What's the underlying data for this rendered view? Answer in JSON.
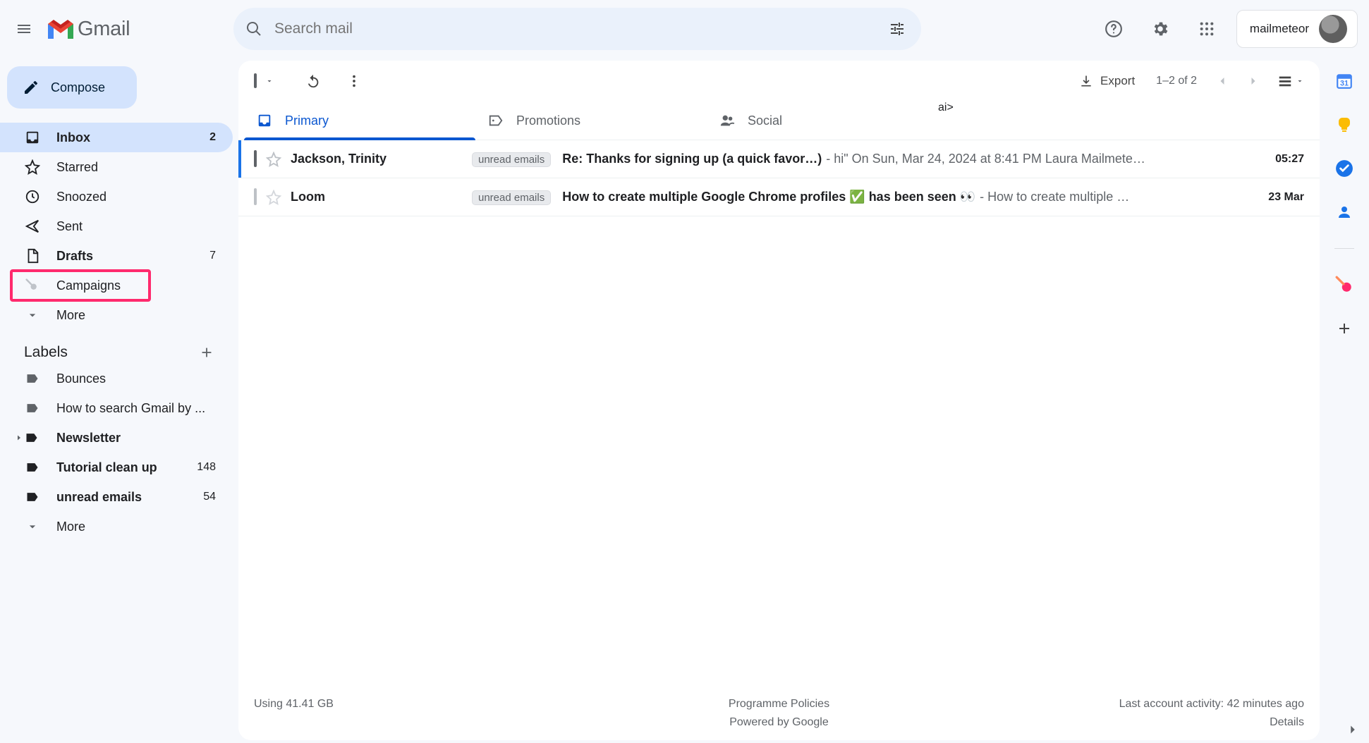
{
  "app": {
    "name": "Gmail"
  },
  "search": {
    "placeholder": "Search mail"
  },
  "header_account": {
    "label": "mailmeteor"
  },
  "compose": {
    "label": "Compose"
  },
  "sidebar": {
    "items": [
      {
        "label": "Inbox",
        "count": "2"
      },
      {
        "label": "Starred",
        "count": ""
      },
      {
        "label": "Snoozed",
        "count": ""
      },
      {
        "label": "Sent",
        "count": ""
      },
      {
        "label": "Drafts",
        "count": "7"
      },
      {
        "label": "Campaigns",
        "count": ""
      },
      {
        "label": "More",
        "count": ""
      }
    ]
  },
  "labels": {
    "heading": "Labels",
    "items": [
      {
        "label": "Bounces",
        "count": ""
      },
      {
        "label": "How to search Gmail by ...",
        "count": ""
      },
      {
        "label": "Newsletter",
        "count": ""
      },
      {
        "label": "Tutorial clean up",
        "count": "148"
      },
      {
        "label": "unread emails",
        "count": "54"
      },
      {
        "label": "More",
        "count": ""
      }
    ]
  },
  "toolbar": {
    "export": "Export",
    "count": "1–2 of 2"
  },
  "tabs": [
    {
      "label": "Primary"
    },
    {
      "label": "Promotions"
    },
    {
      "label": "Social"
    }
  ],
  "rows": [
    {
      "sender": "Jackson, Trinity",
      "chip": "unread emails",
      "subject": "Re: Thanks for signing up (a quick favor…)",
      "snippet": " - hi\" On Sun, Mar 24, 2024 at 8:41 PM Laura Mailmete…",
      "date": "05:27",
      "unread": true
    },
    {
      "sender": "Loom",
      "chip": "unread emails",
      "subject": "How to create multiple Google Chrome profiles ✅ has been seen 👀",
      "snippet": " - How to create multiple …",
      "date": "23 Mar",
      "unread": false
    }
  ],
  "footer": {
    "storage": "Using 41.41 GB",
    "policy": "Programme Policies",
    "powered": "Powered by Google",
    "activity": "Last account activity: 42 minutes ago",
    "details": "Details"
  }
}
